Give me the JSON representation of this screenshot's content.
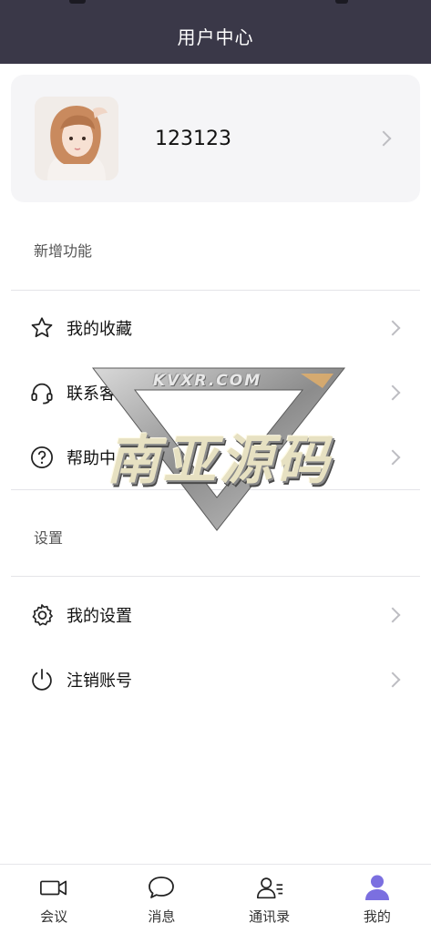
{
  "header": {
    "title": "用户中心"
  },
  "profile": {
    "username": "123123"
  },
  "sections": {
    "new_features": {
      "title": "新增功能",
      "items": [
        {
          "label": "我的收藏",
          "icon": "star-icon"
        },
        {
          "label": "联系客服",
          "icon": "headset-icon"
        },
        {
          "label": "帮助中心",
          "icon": "help-circle-icon"
        }
      ]
    },
    "settings": {
      "title": "设置",
      "items": [
        {
          "label": "我的设置",
          "icon": "gear-icon"
        },
        {
          "label": "注销账号",
          "icon": "power-icon"
        }
      ]
    }
  },
  "watermark": {
    "site": "KVXR.COM",
    "title": "南亚源码"
  },
  "tabbar": {
    "active_color": "#7b6fe0",
    "tabs": [
      {
        "label": "会议",
        "icon": "video-camera-icon",
        "active": false
      },
      {
        "label": "消息",
        "icon": "chat-bubble-icon",
        "active": false
      },
      {
        "label": "通讯录",
        "icon": "contacts-icon",
        "active": false
      },
      {
        "label": "我的",
        "icon": "user-icon",
        "active": true
      }
    ]
  }
}
